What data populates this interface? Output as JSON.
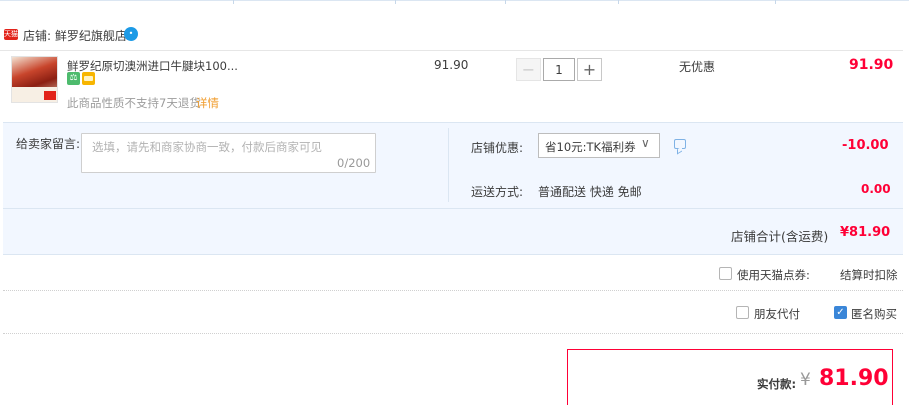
{
  "shop": {
    "badge_text": "天猫",
    "label": "店铺: 鲜罗纪旗舰店",
    "contact_icon": "wangwang-chat-icon",
    "contact_glyph": "•"
  },
  "item": {
    "title": "鲜罗纪原切澳洲进口牛腱块100...",
    "service_icons": [
      "quality-guarantee-icon",
      "credit-card-icon"
    ],
    "service_glyph_1": "⚖",
    "return_note": "此商品性质不支持7天退货",
    "return_link": "详情",
    "unit_price": "91.90",
    "quantity": "1",
    "minus_label": "−",
    "plus_label": "+",
    "discount_status": "无优惠",
    "total": "91.90"
  },
  "memo": {
    "label": "给卖家留言:",
    "placeholder": "选填，请先和商家协商一致，付款后商家可见",
    "counter": "0/200"
  },
  "promotion": {
    "label": "店铺优惠:",
    "selected": "省10元:TK福利券",
    "chevron": "∨",
    "amount": "-10.00"
  },
  "shipping": {
    "label": "运送方式:",
    "method": "普通配送 快递 免邮",
    "fee": "0.00"
  },
  "subtotal": {
    "label": "店铺合计(含运费)",
    "amount": "¥81.90"
  },
  "options": {
    "points_label": "使用天猫点券:",
    "points_note": "结算时扣除",
    "points_checked": false,
    "friend_pay_label": "朋友代付",
    "friend_pay_checked": false,
    "anonymous_label": "匿名购买",
    "anonymous_checked": true,
    "check_glyph": "✓"
  },
  "payment": {
    "label": "实付款:",
    "currency": "¥",
    "amount": "81.90"
  },
  "colors": {
    "accent_red": "#ff0036",
    "panel_bg": "#f2f7ff",
    "checkbox_blue": "#3a86d8",
    "link_orange": "#f09c2c"
  }
}
